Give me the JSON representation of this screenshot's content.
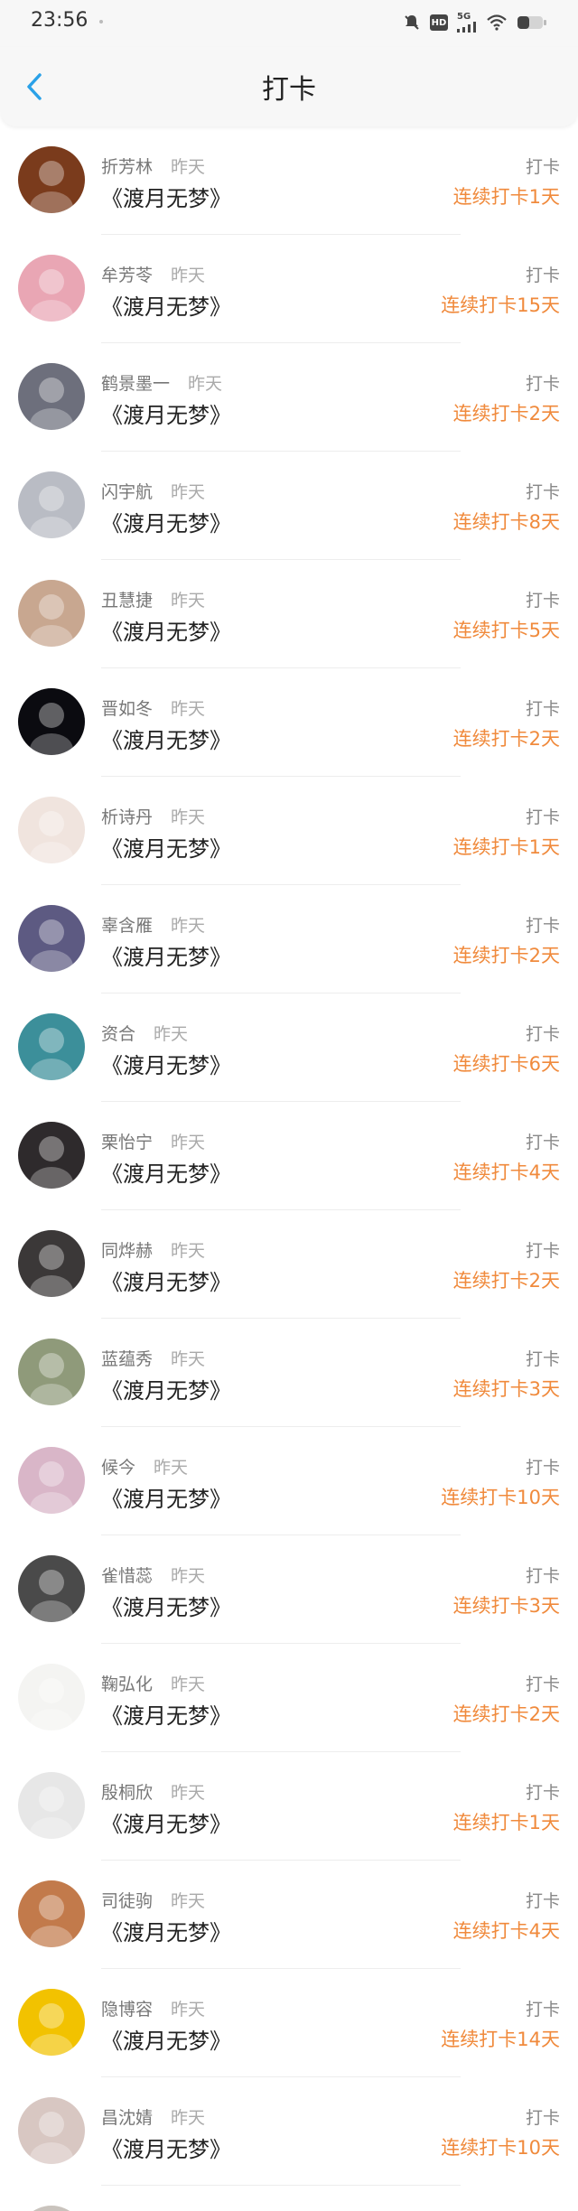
{
  "status_bar": {
    "time": "23:56",
    "network": "5G",
    "hd": "HD"
  },
  "nav": {
    "title": "打卡",
    "back_icon": "chevron-left-icon"
  },
  "colors": {
    "accent": "#2aa1e8",
    "streak": "#f08a3c"
  },
  "items": [
    {
      "name": "折芳林",
      "time": "昨天",
      "book": "《渡月无梦》",
      "action": "打卡",
      "streak": "连续打卡1天",
      "avatar_color": "#7a3b1c"
    },
    {
      "name": "牟芳苓",
      "time": "昨天",
      "book": "《渡月无梦》",
      "action": "打卡",
      "streak": "连续打卡15天",
      "avatar_color": "#e9a6b4"
    },
    {
      "name": "鹤景墨一",
      "time": "昨天",
      "book": "《渡月无梦》",
      "action": "打卡",
      "streak": "连续打卡2天",
      "avatar_color": "#6d6f7c"
    },
    {
      "name": "闪宇航",
      "time": "昨天",
      "book": "《渡月无梦》",
      "action": "打卡",
      "streak": "连续打卡8天",
      "avatar_color": "#b9bcc4"
    },
    {
      "name": "丑慧捷",
      "time": "昨天",
      "book": "《渡月无梦》",
      "action": "打卡",
      "streak": "连续打卡5天",
      "avatar_color": "#c8a790"
    },
    {
      "name": "晋如冬",
      "time": "昨天",
      "book": "《渡月无梦》",
      "action": "打卡",
      "streak": "连续打卡2天",
      "avatar_color": "#0b0b10"
    },
    {
      "name": "析诗丹",
      "time": "昨天",
      "book": "《渡月无梦》",
      "action": "打卡",
      "streak": "连续打卡1天",
      "avatar_color": "#f0e4de"
    },
    {
      "name": "辜含雁",
      "time": "昨天",
      "book": "《渡月无梦》",
      "action": "打卡",
      "streak": "连续打卡2天",
      "avatar_color": "#5d5a82"
    },
    {
      "name": "资合",
      "time": "昨天",
      "book": "《渡月无梦》",
      "action": "打卡",
      "streak": "连续打卡6天",
      "avatar_color": "#3c8f9a"
    },
    {
      "name": "栗怡宁",
      "time": "昨天",
      "book": "《渡月无梦》",
      "action": "打卡",
      "streak": "连续打卡4天",
      "avatar_color": "#2e2a2c"
    },
    {
      "name": "同烨赫",
      "time": "昨天",
      "book": "《渡月无梦》",
      "action": "打卡",
      "streak": "连续打卡2天",
      "avatar_color": "#3b3838"
    },
    {
      "name": "蓝蕴秀",
      "time": "昨天",
      "book": "《渡月无梦》",
      "action": "打卡",
      "streak": "连续打卡3天",
      "avatar_color": "#8f9a7a"
    },
    {
      "name": "候今",
      "time": "昨天",
      "book": "《渡月无梦》",
      "action": "打卡",
      "streak": "连续打卡10天",
      "avatar_color": "#d9b6c8"
    },
    {
      "name": "雀惜蕊",
      "time": "昨天",
      "book": "《渡月无梦》",
      "action": "打卡",
      "streak": "连续打卡3天",
      "avatar_color": "#4a4a4a"
    },
    {
      "name": "鞠弘化",
      "time": "昨天",
      "book": "《渡月无梦》",
      "action": "打卡",
      "streak": "连续打卡2天",
      "avatar_color": "#f4f4f2"
    },
    {
      "name": "殷桐欣",
      "time": "昨天",
      "book": "《渡月无梦》",
      "action": "打卡",
      "streak": "连续打卡1天",
      "avatar_color": "#e7e7e7"
    },
    {
      "name": "司徒驹",
      "time": "昨天",
      "book": "《渡月无梦》",
      "action": "打卡",
      "streak": "连续打卡4天",
      "avatar_color": "#c27a4b"
    },
    {
      "name": "隐博容",
      "time": "昨天",
      "book": "《渡月无梦》",
      "action": "打卡",
      "streak": "连续打卡14天",
      "avatar_color": "#f2c200"
    },
    {
      "name": "昌沈婧",
      "time": "昨天",
      "book": "《渡月无梦》",
      "action": "打卡",
      "streak": "连续打卡10天",
      "avatar_color": "#d8c7c2"
    }
  ]
}
